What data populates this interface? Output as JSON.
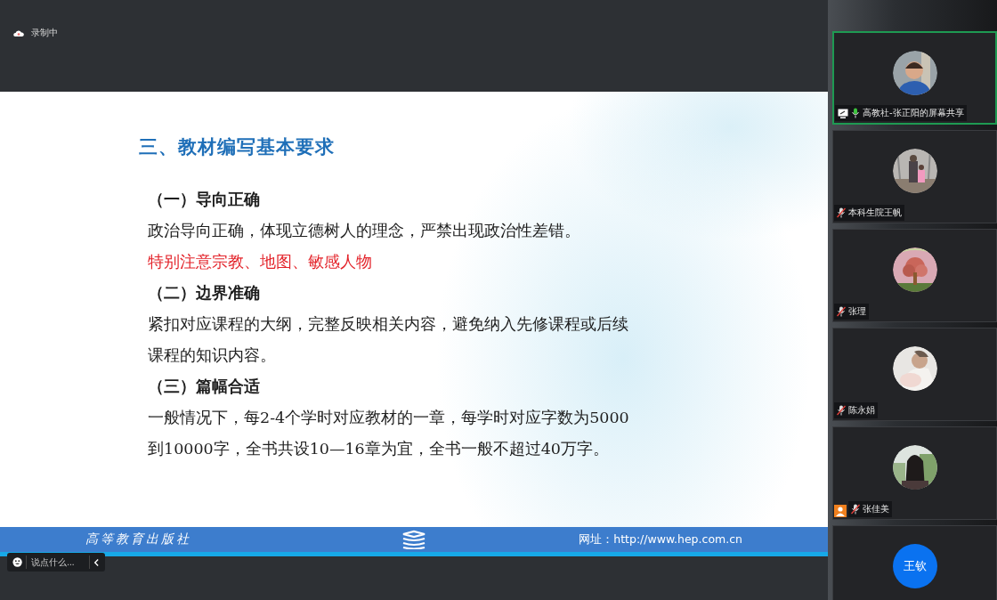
{
  "recording": {
    "label": "录制中"
  },
  "slide": {
    "title": "三、教材编写基本要求",
    "lines": [
      {
        "kind": "heading",
        "text": "（一）导向正确"
      },
      {
        "kind": "body",
        "text": "政治导向正确，体现立德树人的理念，严禁出现政治性差错。"
      },
      {
        "kind": "alert",
        "text": "特别注意宗教、地图、敏感人物"
      },
      {
        "kind": "heading",
        "text": "（二）边界准确"
      },
      {
        "kind": "body",
        "text": "紧扣对应课程的大纲，完整反映相关内容，避免纳入先修课程或后续"
      },
      {
        "kind": "body",
        "text": "课程的知识内容。"
      },
      {
        "kind": "heading",
        "text": "（三）篇幅合适"
      },
      {
        "kind": "body",
        "text": "一般情况下，每2-4个学时对应教材的一章，每学时对应字数为5000"
      },
      {
        "kind": "body",
        "text": "到10000字，全书共设10—16章为宜，全书一般不超过40万字。"
      }
    ],
    "footer": {
      "publisher": "高等教育出版社",
      "website": "网址：http://www.hep.com.cn"
    }
  },
  "chat": {
    "placeholder": "说点什么..."
  },
  "participants": [
    {
      "name": "高教社-张正阳的屏幕共享",
      "selected": true,
      "screen_share": true,
      "muted": false,
      "host": false
    },
    {
      "name": "本科生院王帆",
      "selected": false,
      "screen_share": false,
      "muted": true,
      "host": false
    },
    {
      "name": "张理",
      "selected": false,
      "screen_share": false,
      "muted": true,
      "host": false
    },
    {
      "name": "陈永娟",
      "selected": false,
      "screen_share": false,
      "muted": true,
      "host": false
    },
    {
      "name": "张佳美",
      "selected": false,
      "screen_share": false,
      "muted": true,
      "host": true
    },
    {
      "selected": false,
      "avatar": {
        "kind": "initials",
        "text": "王钦"
      }
    }
  ]
}
